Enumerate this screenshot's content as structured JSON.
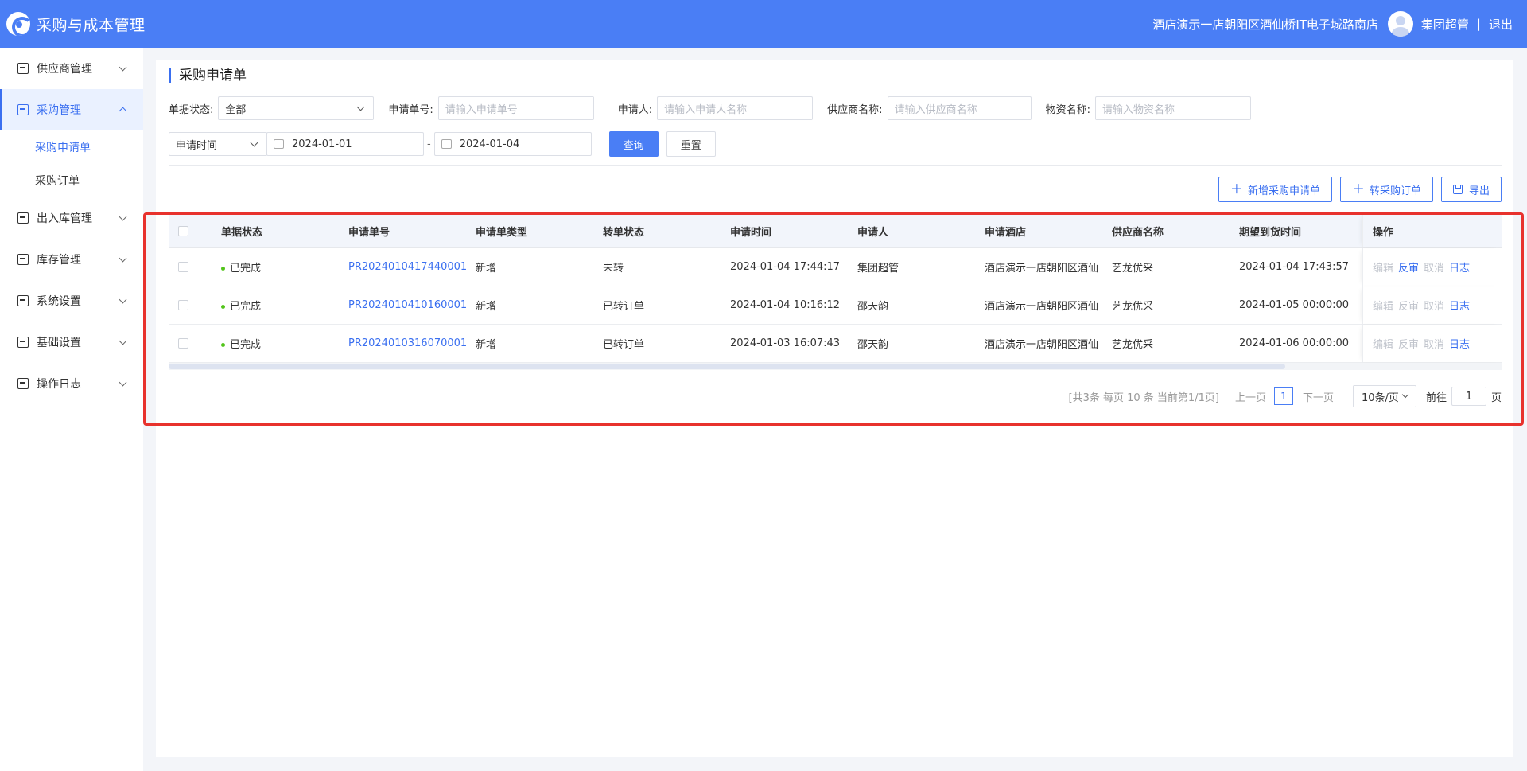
{
  "header": {
    "app_title": "采购与成本管理",
    "hotel_name": "酒店演示一店朝阳区酒仙桥IT电子城路南店",
    "user_name": "集团超管",
    "separator": "|",
    "logout_label": "退出"
  },
  "sidebar": {
    "items": [
      {
        "label": "供应商管理"
      },
      {
        "label": "采购管理"
      },
      {
        "label": "出入库管理"
      },
      {
        "label": "库存管理"
      },
      {
        "label": "系统设置"
      },
      {
        "label": "基础设置"
      },
      {
        "label": "操作日志"
      }
    ],
    "sub_items": [
      {
        "label": "采购申请单"
      },
      {
        "label": "采购订单"
      }
    ]
  },
  "page": {
    "title": "采购申请单"
  },
  "filters": {
    "status_label": "单据状态:",
    "status_value": "全部",
    "req_no_label": "申请单号:",
    "req_no_placeholder": "请输入申请单号",
    "applicant_label": "申请人:",
    "applicant_placeholder": "请输入申请人名称",
    "supplier_label": "供应商名称:",
    "supplier_placeholder": "请输入供应商名称",
    "material_label": "物资名称:",
    "material_placeholder": "请输入物资名称",
    "date_type_value": "申请时间",
    "date_start": "2024-01-01",
    "date_sep": "-",
    "date_end": "2024-01-04",
    "query_label": "查询",
    "reset_label": "重置"
  },
  "actions": {
    "add_label": "新增采购申请单",
    "convert_label": "转采购订单",
    "export_label": "导出"
  },
  "table": {
    "columns": [
      "单据状态",
      "申请单号",
      "申请单类型",
      "转单状态",
      "申请时间",
      "申请人",
      "申请酒店",
      "供应商名称",
      "期望到货时间",
      "操作"
    ],
    "rows": [
      {
        "status": "已完成",
        "no": "PR2024010417440001",
        "type": "新增",
        "convert": "未转",
        "time": "2024-01-04 17:44:17",
        "applicant": "集团超管",
        "hotel": "酒店演示一店朝阳区酒仙",
        "supplier": "艺龙优采",
        "expected": "2024-01-04 17:43:57",
        "ops": [
          "编辑",
          "反审",
          "取消",
          "日志"
        ]
      },
      {
        "status": "已完成",
        "no": "PR2024010410160001",
        "type": "新增",
        "convert": "已转订单",
        "time": "2024-01-04 10:16:12",
        "applicant": "邵天韵",
        "hotel": "酒店演示一店朝阳区酒仙",
        "supplier": "艺龙优采",
        "expected": "2024-01-05 00:00:00",
        "ops": [
          "编辑",
          "反审",
          "取消",
          "日志"
        ]
      },
      {
        "status": "已完成",
        "no": "PR2024010316070001",
        "type": "新增",
        "convert": "已转订单",
        "time": "2024-01-03 16:07:43",
        "applicant": "邵天韵",
        "hotel": "酒店演示一店朝阳区酒仙",
        "supplier": "艺龙优采",
        "expected": "2024-01-06 00:00:00",
        "ops": [
          "编辑",
          "反审",
          "取消",
          "日志"
        ]
      }
    ]
  },
  "pager": {
    "info": "[共3条 每页 10 条 当前第1/1页]",
    "prev": "上一页",
    "current": "1",
    "next": "下一页",
    "size": "10条/页",
    "goto": "前往",
    "goto_value": "1",
    "unit": "页"
  },
  "colors": {
    "primary": "#4a7ef5",
    "highlight": "#e8322d",
    "status_dot": "#52c41a"
  }
}
